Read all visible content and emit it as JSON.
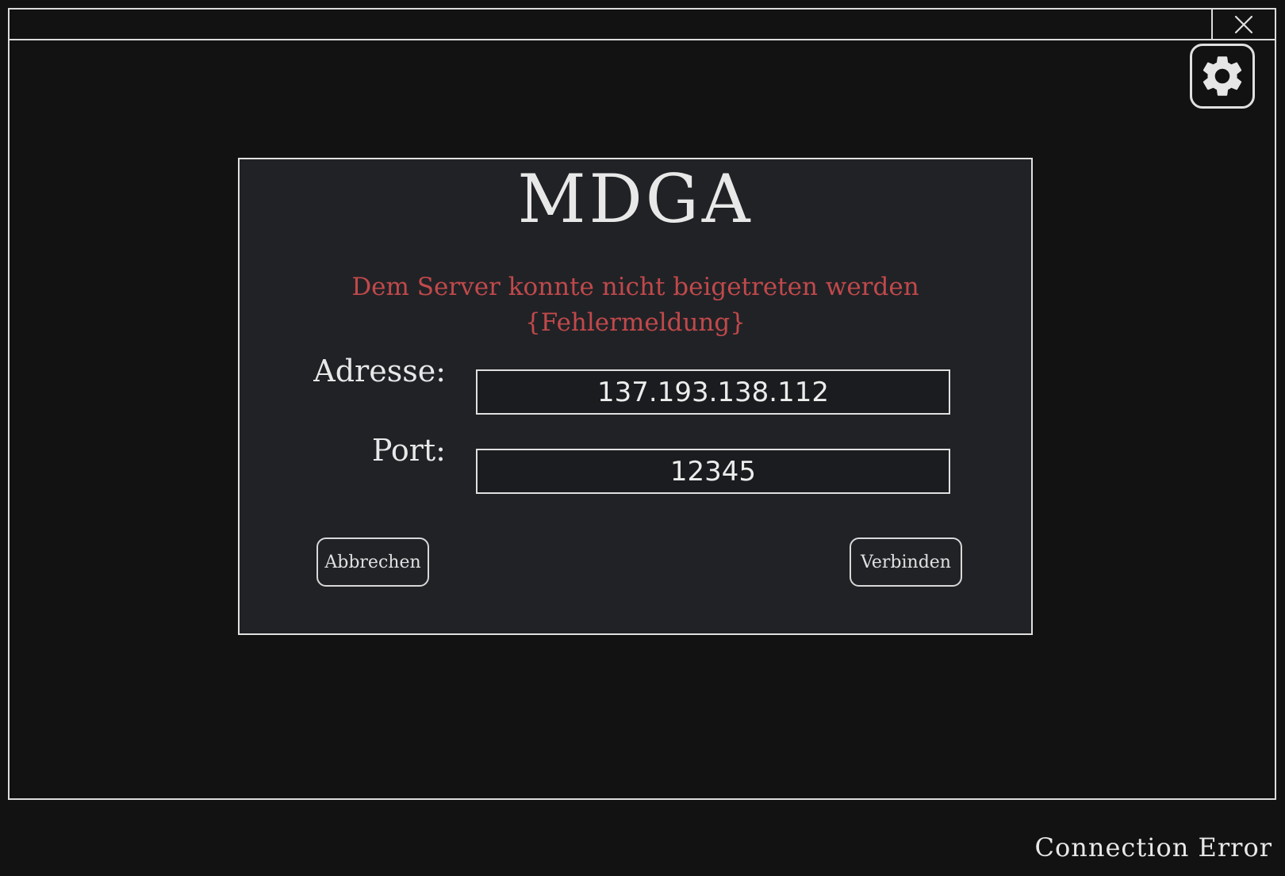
{
  "app": {
    "title": "MDGA"
  },
  "dialog": {
    "error_line1": "Dem Server konnte nicht beigetreten werden",
    "error_line2": "{Fehlermeldung}",
    "address_label": "Adresse:",
    "address_value": "137.193.138.112",
    "port_label": "Port:",
    "port_value": "12345",
    "cancel_label": "Abbrechen",
    "connect_label": "Verbinden"
  },
  "window": {
    "close_icon": "close-icon",
    "settings_icon": "gear-icon"
  },
  "status": {
    "text": "Connection Error"
  },
  "colors": {
    "background": "#121212",
    "dialog_background": "#212226",
    "error_text": "#c0494b",
    "foreground": "#e6e6e6"
  }
}
